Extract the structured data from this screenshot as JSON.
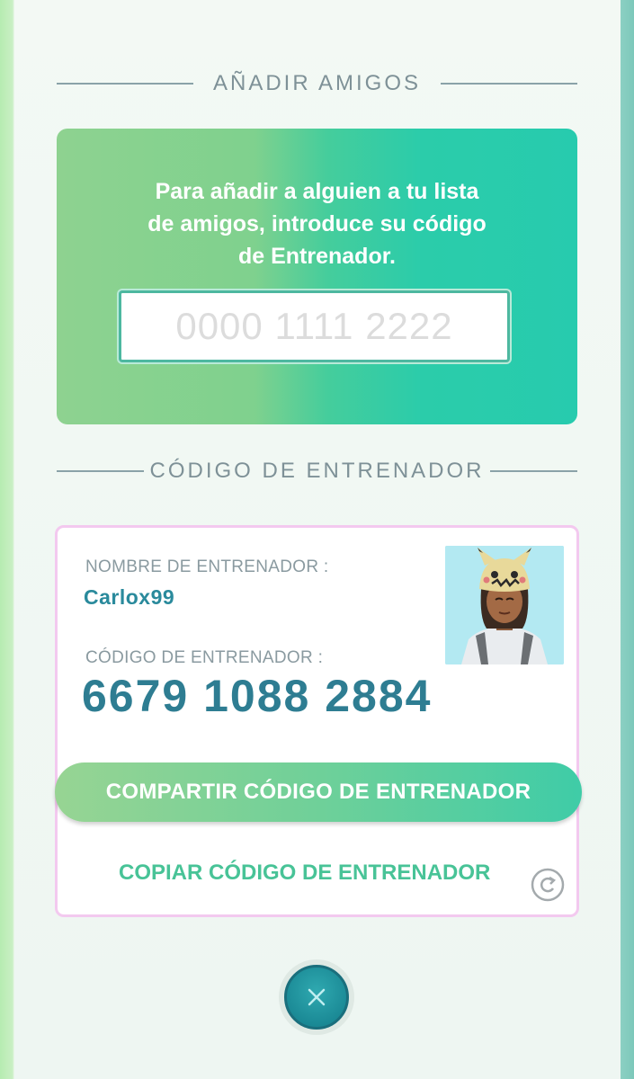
{
  "add_friends": {
    "section_title": "AÑADIR AMIGOS",
    "instructions_line1": "Para añadir a alguien a tu lista",
    "instructions_line2": "de amigos, introduce su código",
    "instructions_line3": "de Entrenador.",
    "code_input": {
      "value": "",
      "placeholder": "0000 1111 2222"
    }
  },
  "trainer_code": {
    "section_title": "CÓDIGO DE ENTRENADOR",
    "name_label": "NOMBRE DE ENTRENADOR :",
    "name": "Carlox99",
    "code_label": "CÓDIGO DE ENTRENADOR :",
    "code": "6679 1088 2884",
    "share_button": "COMPARTIR CÓDIGO DE ENTRENADOR",
    "copy_link": "COPIAR CÓDIGO DE ENTRENADOR",
    "avatar": "trainer-avatar"
  },
  "icons": {
    "copy": "copy-icon",
    "close": "close-icon"
  },
  "colors": {
    "accent_teal": "#2bccaa",
    "accent_green": "#8ed290",
    "code_text": "#2e7d92",
    "card_border": "#f3c9ef",
    "close_button": "#1b8a96"
  }
}
